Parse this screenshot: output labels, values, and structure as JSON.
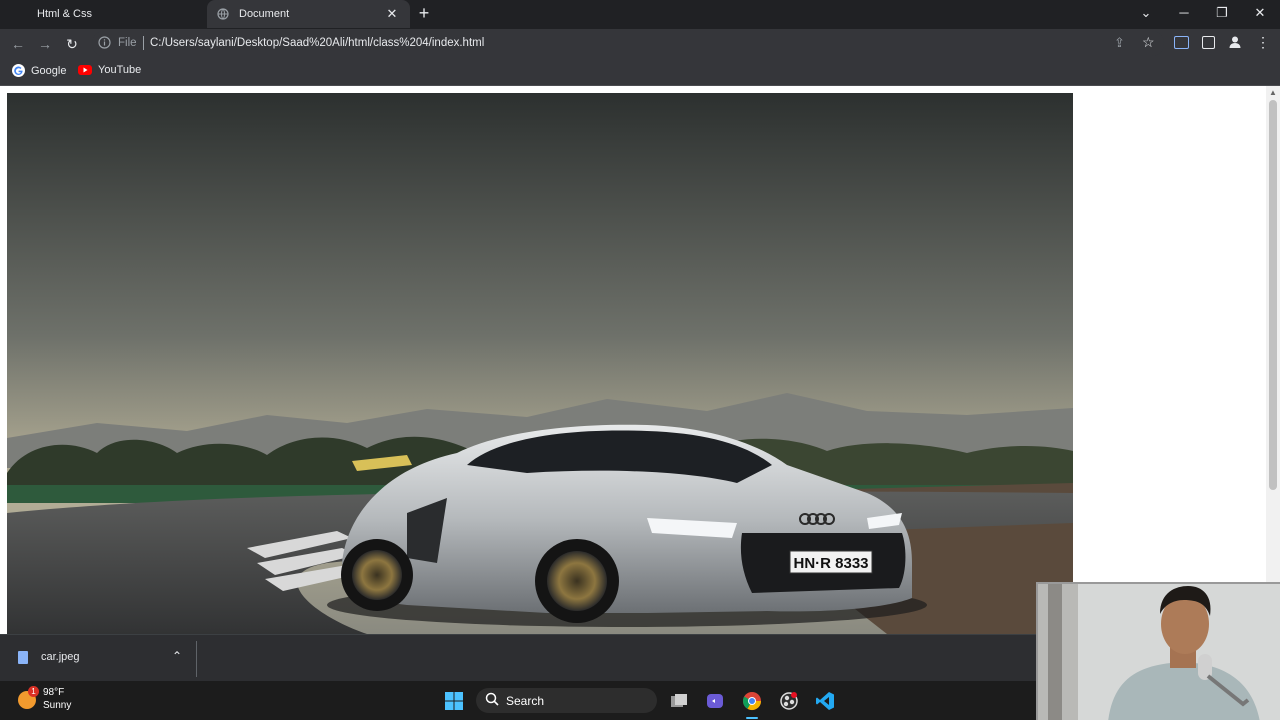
{
  "tabs": [
    {
      "title": "Html & Css",
      "active": false
    },
    {
      "title": "Document",
      "active": true
    }
  ],
  "toolbar": {
    "url_scheme": "File",
    "url": "C:/Users/saylani/Desktop/Saad%20Ali/html/class%204/index.html"
  },
  "bookmarks": [
    {
      "label": "Google",
      "icon": "google-icon"
    },
    {
      "label": "YouTube",
      "icon": "youtube-icon"
    }
  ],
  "image": {
    "plate_text": "HN·R 8333"
  },
  "downloads": {
    "filename": "car.jpeg"
  },
  "taskbar": {
    "weather_temp": "98°F",
    "weather_desc": "Sunny",
    "weather_badge": "1",
    "search_label": "Search"
  },
  "colors": {
    "chrome_dark": "#202124",
    "toolbar": "#35363a",
    "taskbar": "#1c1c1c"
  }
}
